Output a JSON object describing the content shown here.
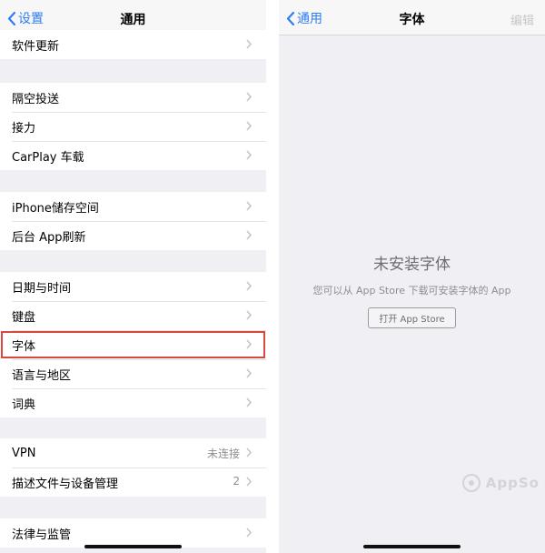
{
  "left": {
    "back_label": "设置",
    "title": "通用",
    "groups": [
      {
        "items": [
          {
            "label": "软件更新"
          }
        ]
      },
      {
        "items": [
          {
            "label": "隔空投送"
          },
          {
            "label": "接力"
          },
          {
            "label": "CarPlay 车载"
          }
        ]
      },
      {
        "items": [
          {
            "label": "iPhone储存空间"
          },
          {
            "label": "后台 App刷新"
          }
        ]
      },
      {
        "items": [
          {
            "label": "日期与时间"
          },
          {
            "label": "键盘"
          },
          {
            "label": "字体",
            "highlighted": true
          },
          {
            "label": "语言与地区"
          },
          {
            "label": "词典"
          }
        ]
      },
      {
        "items": [
          {
            "label": "VPN",
            "detail": "未连接"
          },
          {
            "label": "描述文件与设备管理",
            "detail": "2"
          }
        ]
      },
      {
        "items": [
          {
            "label": "法律与监管"
          }
        ]
      }
    ]
  },
  "right": {
    "back_label": "通用",
    "title": "字体",
    "edit_label": "编辑",
    "empty_title": "未安装字体",
    "empty_subtitle": "您可以从 App Store 下载可安装字体的 App",
    "open_store_label": "打开 App Store",
    "watermark": "AppSo"
  },
  "colors": {
    "accent": "#2f7cf6",
    "highlight_border": "#d9473f",
    "background": "#efeff4"
  },
  "icons": {
    "back": "chevron-left-icon",
    "disclosure": "chevron-right-icon"
  }
}
